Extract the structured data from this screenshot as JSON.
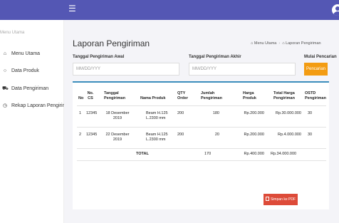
{
  "topbar": {
    "menu_icon": "☰"
  },
  "sidebar": {
    "heading": "Menu Utama",
    "items": [
      {
        "icon": "dashboard-icon",
        "glyph": "🏠",
        "label": "Menu Utama"
      },
      {
        "icon": "circle-icon",
        "glyph": "○",
        "label": "Data Produk"
      },
      {
        "icon": "truck-icon",
        "glyph": "🚚",
        "label": "Data Pengiriman"
      },
      {
        "icon": "clock-icon",
        "glyph": "⏲",
        "label": "Rekap Laporan Pengiriman"
      }
    ]
  },
  "page": {
    "title": "Laporan Pengiriman",
    "breadcrumb": [
      "Menu Utama",
      "Laporan Pengiriman"
    ]
  },
  "filters": {
    "start_label": "Tanggal Pengiriman Awal",
    "start_placeholder": "MM/DD/YYY",
    "end_label": "Tanggal Pengiriman Akhir",
    "end_placeholder": "MM/DD/YYY",
    "search_label": "Mulai Pencarian",
    "search_button": "Pencarian"
  },
  "table": {
    "headers": [
      "No",
      "No. CS",
      "Tanggal Pengiriman",
      "Nama Produk",
      "QTY Order",
      "Jumlah Pengiriman",
      "Harga Produk",
      "Total Harga Pengiriman",
      "OSTD Pengiriman"
    ],
    "rows": [
      [
        "1",
        "12345",
        "18 Desember 2019",
        "Beam H.125 L.2300 mm",
        "200",
        "180",
        "Rp.200.000",
        "Rp.30.000.000",
        "30"
      ],
      [
        "2",
        "12345",
        "22 Desember 2019",
        "Beam H.125 L.2300 mm",
        "200",
        "20",
        "Rp.200.000",
        "Rp.4.000.000",
        "30"
      ]
    ],
    "total": {
      "label": "TOTAL",
      "jumlah": "170",
      "harga": "Rp.400.000",
      "total_harga": "Rp.34.000.000"
    }
  },
  "actions": {
    "pdf_button": "Simpan ke PDF"
  },
  "colors": {
    "topbar": "#5457b4",
    "search_button": "#f39c12",
    "pdf_button": "#dd4b39",
    "table_accent": "#3c8dbc"
  }
}
